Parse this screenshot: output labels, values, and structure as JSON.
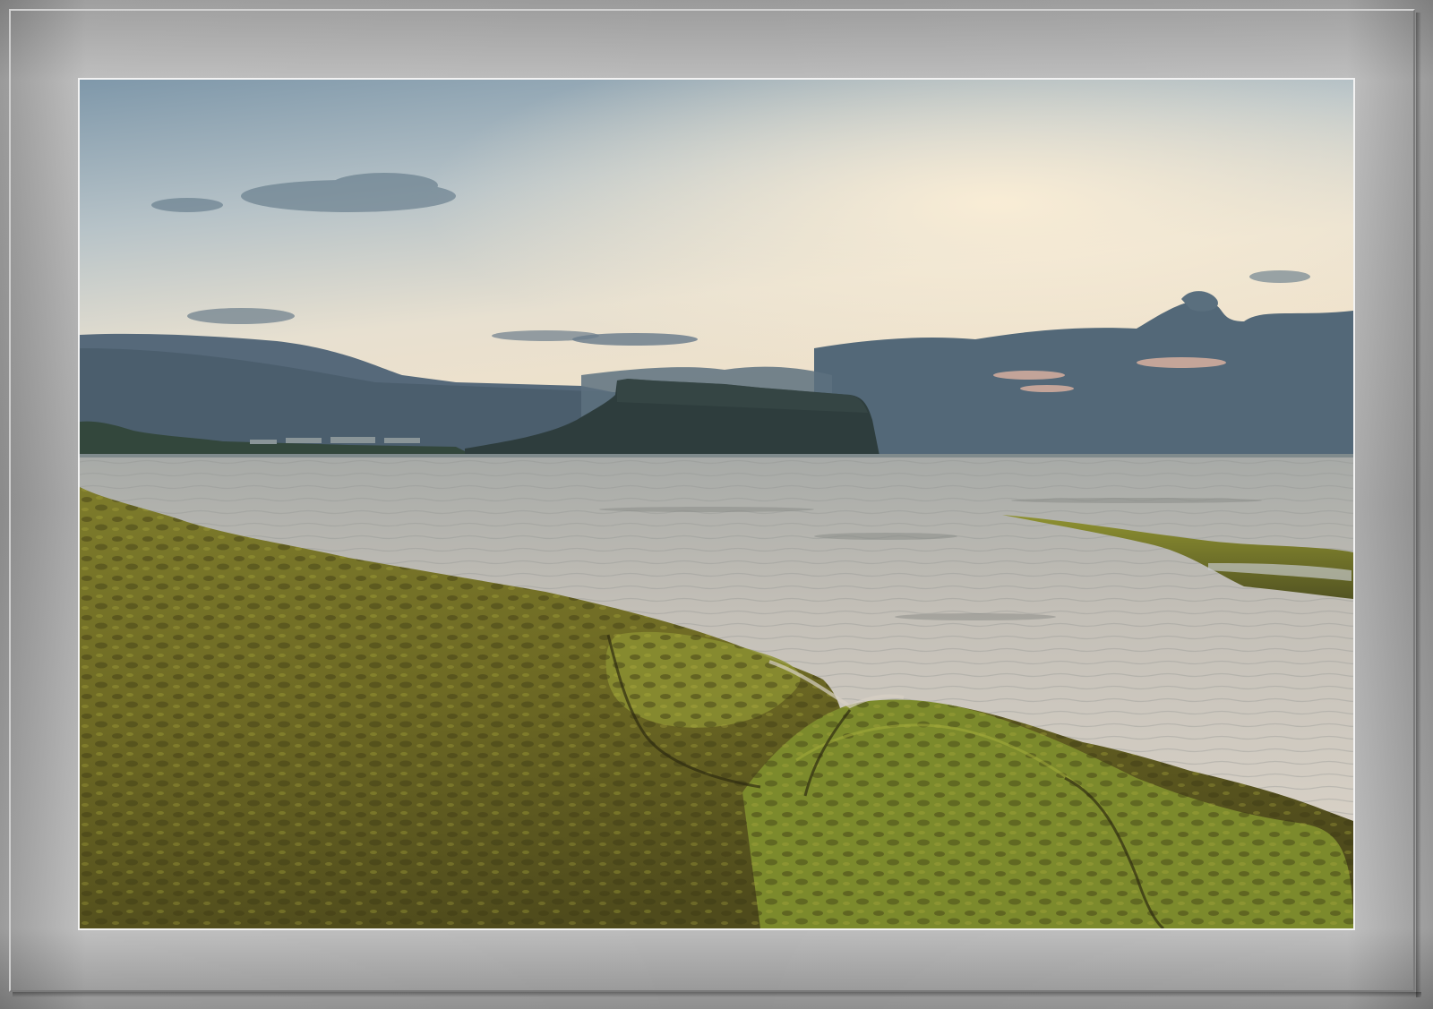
{
  "scene": {
    "subject": "",
    "colors": {
      "sky_top": "#7f9aae",
      "sky_mid": "#c9cfcf",
      "sky_glow": "#f4e6cf",
      "cloud_dark": "#4e6371",
      "headland": "#2c3b3b",
      "sea": "#b5b4b0",
      "sea_light": "#d8d1c6",
      "moss": "#7a7a2a",
      "moss_bright": "#9a9a30",
      "moss_dark": "#3e3b17",
      "frame_gray": "#aaaaaa"
    }
  }
}
